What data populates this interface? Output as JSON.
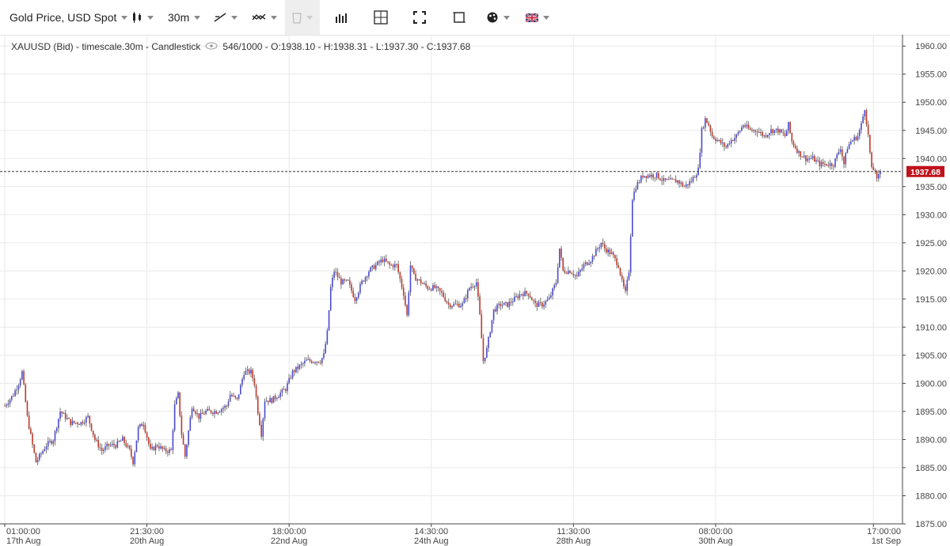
{
  "toolbar": {
    "instrument_label": "Gold Price, USD Spot",
    "timeframe_label": "30m",
    "icons": [
      "candlestick-type-icon",
      "draw-line-icon",
      "indicator-icon",
      "delete-icon",
      "volume-bars-icon",
      "crosshair-icon",
      "fullscreen-icon",
      "fit-screen-icon",
      "settings-palette-icon",
      "language-flag-icon"
    ]
  },
  "info": {
    "series_text": "XAUUSD (Bid) - timescale.30m - Candlestick",
    "stats_text": "546/1000 - O:1938.10 - H:1938.31 - L:1937.30 - C:1937.68"
  },
  "colors": {
    "up": "#4a4ad0",
    "down": "#c0392b",
    "wick": "#777777",
    "grid": "#e9e9e9",
    "last_price_bg": "#c0121b"
  },
  "chart_data": {
    "type": "candlestick",
    "symbol": "XAUUSD (Bid)",
    "timeframe": "30m",
    "ylim": [
      1875,
      1962
    ],
    "y_ticks": [
      1960,
      1955,
      1950,
      1945,
      1940,
      1935,
      1930,
      1925,
      1920,
      1915,
      1910,
      1905,
      1900,
      1895,
      1890,
      1885,
      1880,
      1875
    ],
    "y_tick_labels": [
      "1960.00",
      "1955.00",
      "1950.00",
      "1945.00",
      "1940.00",
      "1935.00",
      "1930.00",
      "1925.00",
      "1920.00",
      "1915.00",
      "1910.00",
      "1905.00",
      "1900.00",
      "1895.00",
      "1890.00",
      "1885.00",
      "1880.00",
      "1875.00"
    ],
    "x_ticks": [
      {
        "time": "01:00:00",
        "date": "17th Aug",
        "index": 0
      },
      {
        "time": "21:30:00",
        "date": "20th Aug",
        "index": 82
      },
      {
        "time": "18:00:00",
        "date": "22nd Aug",
        "index": 164
      },
      {
        "time": "14:30:00",
        "date": "24th Aug",
        "index": 246
      },
      {
        "time": "11:30:00",
        "date": "28th Aug",
        "index": 328
      },
      {
        "time": "08:00:00",
        "date": "30th Aug",
        "index": 410
      },
      {
        "time": "17:00:00",
        "date": "1st Sep",
        "index": 501
      }
    ],
    "last_price": 1937.68,
    "last_price_label": "1937.68",
    "close_path": [
      [
        0,
        1896
      ],
      [
        5,
        1898
      ],
      [
        8,
        1900
      ],
      [
        10,
        1902
      ],
      [
        13,
        1894
      ],
      [
        16,
        1889
      ],
      [
        18,
        1886
      ],
      [
        20,
        1887
      ],
      [
        24,
        1889
      ],
      [
        28,
        1890
      ],
      [
        32,
        1895
      ],
      [
        38,
        1893
      ],
      [
        44,
        1893
      ],
      [
        48,
        1894
      ],
      [
        52,
        1890
      ],
      [
        56,
        1888
      ],
      [
        60,
        1889
      ],
      [
        64,
        1889
      ],
      [
        68,
        1890
      ],
      [
        72,
        1888
      ],
      [
        74,
        1886
      ],
      [
        77,
        1892
      ],
      [
        80,
        1893
      ],
      [
        84,
        1888
      ],
      [
        88,
        1889
      ],
      [
        92,
        1888
      ],
      [
        96,
        1888
      ],
      [
        98,
        1896
      ],
      [
        100,
        1898
      ],
      [
        102,
        1891
      ],
      [
        104,
        1887
      ],
      [
        108,
        1896
      ],
      [
        112,
        1894
      ],
      [
        116,
        1895
      ],
      [
        122,
        1895
      ],
      [
        128,
        1896
      ],
      [
        130,
        1898
      ],
      [
        134,
        1897
      ],
      [
        138,
        1902
      ],
      [
        142,
        1902
      ],
      [
        144,
        1900
      ],
      [
        146,
        1895
      ],
      [
        148,
        1891
      ],
      [
        150,
        1897
      ],
      [
        154,
        1897
      ],
      [
        158,
        1898
      ],
      [
        162,
        1899
      ],
      [
        166,
        1902
      ],
      [
        170,
        1903
      ],
      [
        174,
        1904
      ],
      [
        178,
        1904
      ],
      [
        182,
        1904
      ],
      [
        184,
        1905
      ],
      [
        186,
        1909
      ],
      [
        188,
        1917
      ],
      [
        190,
        1920
      ],
      [
        194,
        1918
      ],
      [
        198,
        1918
      ],
      [
        202,
        1915
      ],
      [
        206,
        1918
      ],
      [
        210,
        1920
      ],
      [
        214,
        1921
      ],
      [
        218,
        1922
      ],
      [
        222,
        1921
      ],
      [
        226,
        1921
      ],
      [
        230,
        1916
      ],
      [
        232,
        1912
      ],
      [
        234,
        1921
      ],
      [
        236,
        1919
      ],
      [
        240,
        1918
      ],
      [
        244,
        1917
      ],
      [
        248,
        1917
      ],
      [
        252,
        1916
      ],
      [
        256,
        1914
      ],
      [
        260,
        1914
      ],
      [
        264,
        1914
      ],
      [
        268,
        1917
      ],
      [
        272,
        1918
      ],
      [
        274,
        1912
      ],
      [
        276,
        1904
      ],
      [
        278,
        1906
      ],
      [
        282,
        1913
      ],
      [
        286,
        1914
      ],
      [
        290,
        1914
      ],
      [
        294,
        1915
      ],
      [
        298,
        1916
      ],
      [
        302,
        1916
      ],
      [
        306,
        1914
      ],
      [
        310,
        1914
      ],
      [
        314,
        1915
      ],
      [
        318,
        1918
      ],
      [
        320,
        1924
      ],
      [
        322,
        1920
      ],
      [
        326,
        1920
      ],
      [
        330,
        1919
      ],
      [
        334,
        1921
      ],
      [
        338,
        1922
      ],
      [
        342,
        1924
      ],
      [
        344,
        1925
      ],
      [
        346,
        1924
      ],
      [
        350,
        1923
      ],
      [
        354,
        1921
      ],
      [
        356,
        1918
      ],
      [
        358,
        1916
      ],
      [
        360,
        1920
      ],
      [
        362,
        1933
      ],
      [
        364,
        1935
      ],
      [
        368,
        1937
      ],
      [
        372,
        1937
      ],
      [
        376,
        1937
      ],
      [
        380,
        1936
      ],
      [
        384,
        1936
      ],
      [
        388,
        1936
      ],
      [
        392,
        1935
      ],
      [
        396,
        1936
      ],
      [
        398,
        1937
      ],
      [
        400,
        1938
      ],
      [
        402,
        1945
      ],
      [
        404,
        1947
      ],
      [
        406,
        1946
      ],
      [
        408,
        1944
      ],
      [
        412,
        1943
      ],
      [
        416,
        1942
      ],
      [
        418,
        1943
      ],
      [
        422,
        1944
      ],
      [
        426,
        1946
      ],
      [
        430,
        1945
      ],
      [
        434,
        1945
      ],
      [
        438,
        1944
      ],
      [
        442,
        1945
      ],
      [
        446,
        1945
      ],
      [
        450,
        1944
      ],
      [
        452,
        1946
      ],
      [
        454,
        1943
      ],
      [
        458,
        1941
      ],
      [
        462,
        1940
      ],
      [
        466,
        1940
      ],
      [
        470,
        1939
      ],
      [
        474,
        1939
      ],
      [
        478,
        1939
      ],
      [
        482,
        1942
      ],
      [
        484,
        1939
      ],
      [
        486,
        1942
      ],
      [
        488,
        1943
      ],
      [
        492,
        1944
      ],
      [
        494,
        1946
      ],
      [
        496,
        1949
      ],
      [
        498,
        1944
      ],
      [
        500,
        1938
      ],
      [
        502,
        1938
      ],
      [
        503,
        1936
      ],
      [
        505,
        1937.68
      ]
    ]
  }
}
